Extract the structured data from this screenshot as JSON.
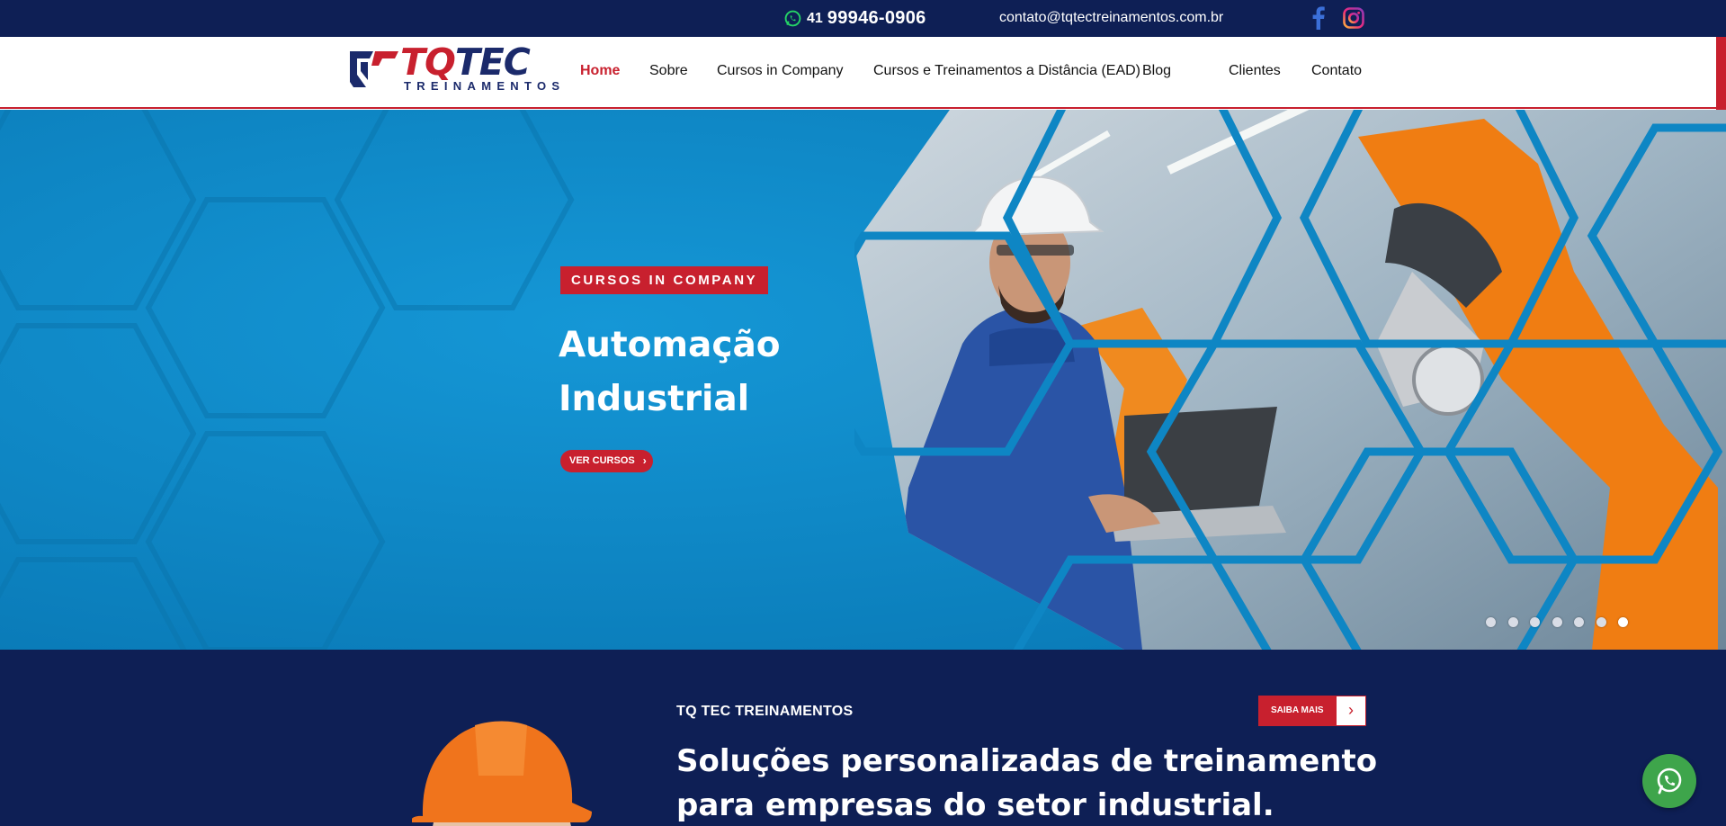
{
  "topbar": {
    "phone_ddd": "41",
    "phone_number": "99946-0906",
    "email": "contato@tqtectreinamentos.com.br",
    "icons": [
      "whatsapp-icon",
      "facebook-icon",
      "instagram-icon"
    ]
  },
  "logo": {
    "brand_prefix": "TQ",
    "brand_suffix": "TEC",
    "subtitle": "TREINAMENTOS"
  },
  "nav": {
    "items": [
      {
        "label": "Home",
        "active": true
      },
      {
        "label": "Sobre"
      },
      {
        "label": "Cursos in Company"
      },
      {
        "label": "Cursos e Treinamentos a Distância (EAD)"
      },
      {
        "label": "Blog"
      },
      {
        "label": "Clientes"
      },
      {
        "label": "Contato"
      }
    ]
  },
  "hero": {
    "badge": "CURSOS IN COMPANY",
    "title_line1": "Automação",
    "title_line2": "Industrial",
    "button_label": "VER CURSOS",
    "slide_count": 7,
    "active_slide": 7
  },
  "about": {
    "label": "TQ TEC TREINAMENTOS",
    "button_label": "SAIBA MAIS",
    "headline_line1": "Soluções personalizadas de treinamento",
    "headline_line2": "para empresas do setor industrial."
  },
  "colors": {
    "navy": "#0e1f55",
    "brand_red": "#c8202e",
    "hero_blue": "#0e86c4",
    "whatsapp_green": "#3ea54b"
  }
}
